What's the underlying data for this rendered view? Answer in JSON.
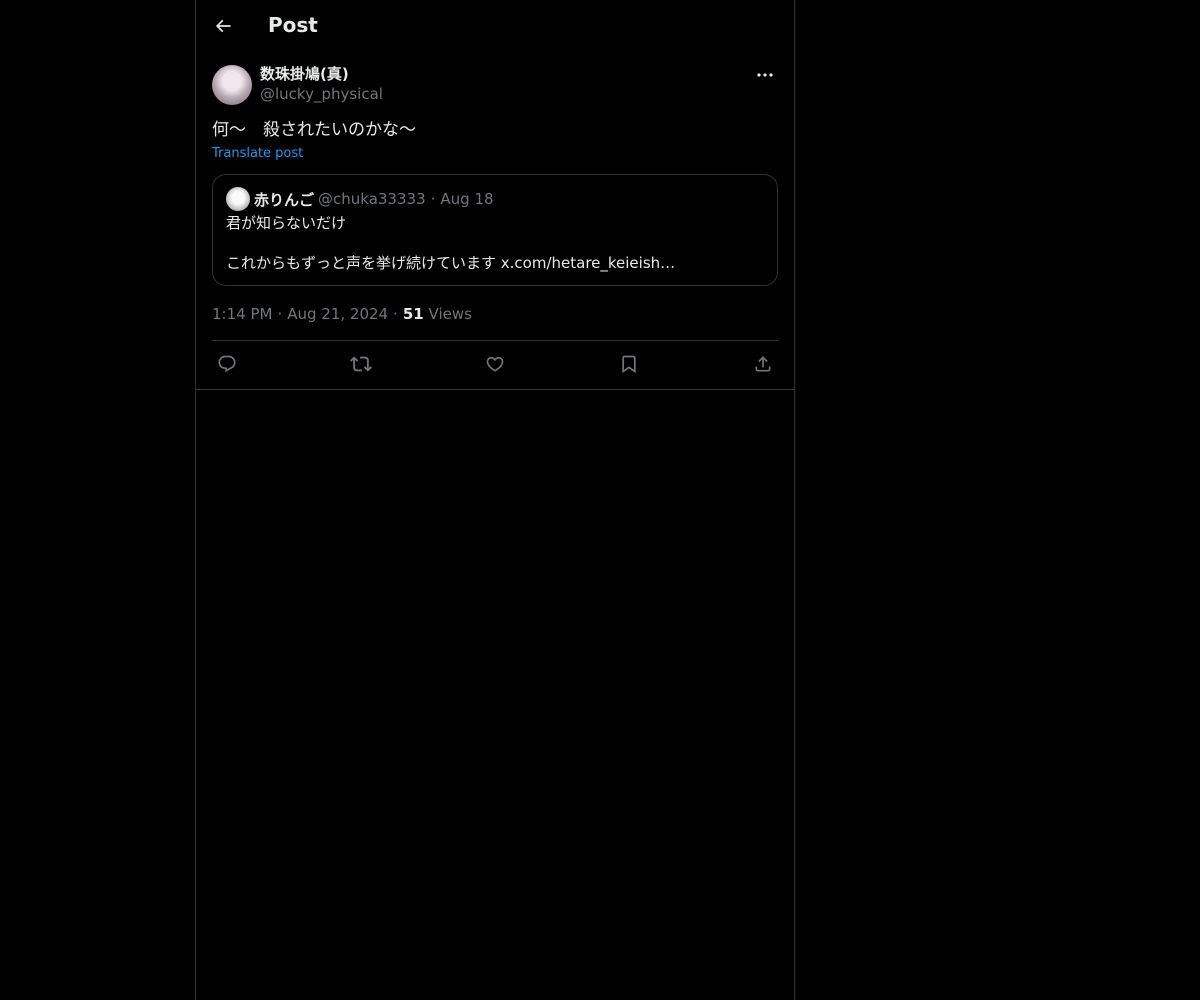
{
  "header": {
    "title": "Post",
    "back_icon": "arrow-left-icon"
  },
  "post": {
    "author": {
      "display_name": "数珠掛鳩(真)",
      "handle": "@lucky_physical"
    },
    "text": "何〜　殺されたいのかな〜",
    "translate_label": "Translate post",
    "quote": {
      "display_name": "赤りんご",
      "handle": "@chuka33333",
      "separator": "·",
      "date": "Aug 18",
      "line1": "君が知らないだけ",
      "line2": "これからもずっと声を挙げ続けています x.com/hetare_keieish…"
    },
    "meta": {
      "time": "1:14 PM",
      "separator": "·",
      "date": "Aug 21, 2024",
      "views_count": "51",
      "views_label": "Views"
    },
    "actions": [
      "reply-icon",
      "repost-icon",
      "like-icon",
      "bookmark-icon",
      "share-icon"
    ]
  },
  "colors": {
    "background": "#000000",
    "text": "#e7e9ea",
    "muted": "#71767b",
    "link": "#1d9bf0",
    "border": "#2f3336"
  }
}
